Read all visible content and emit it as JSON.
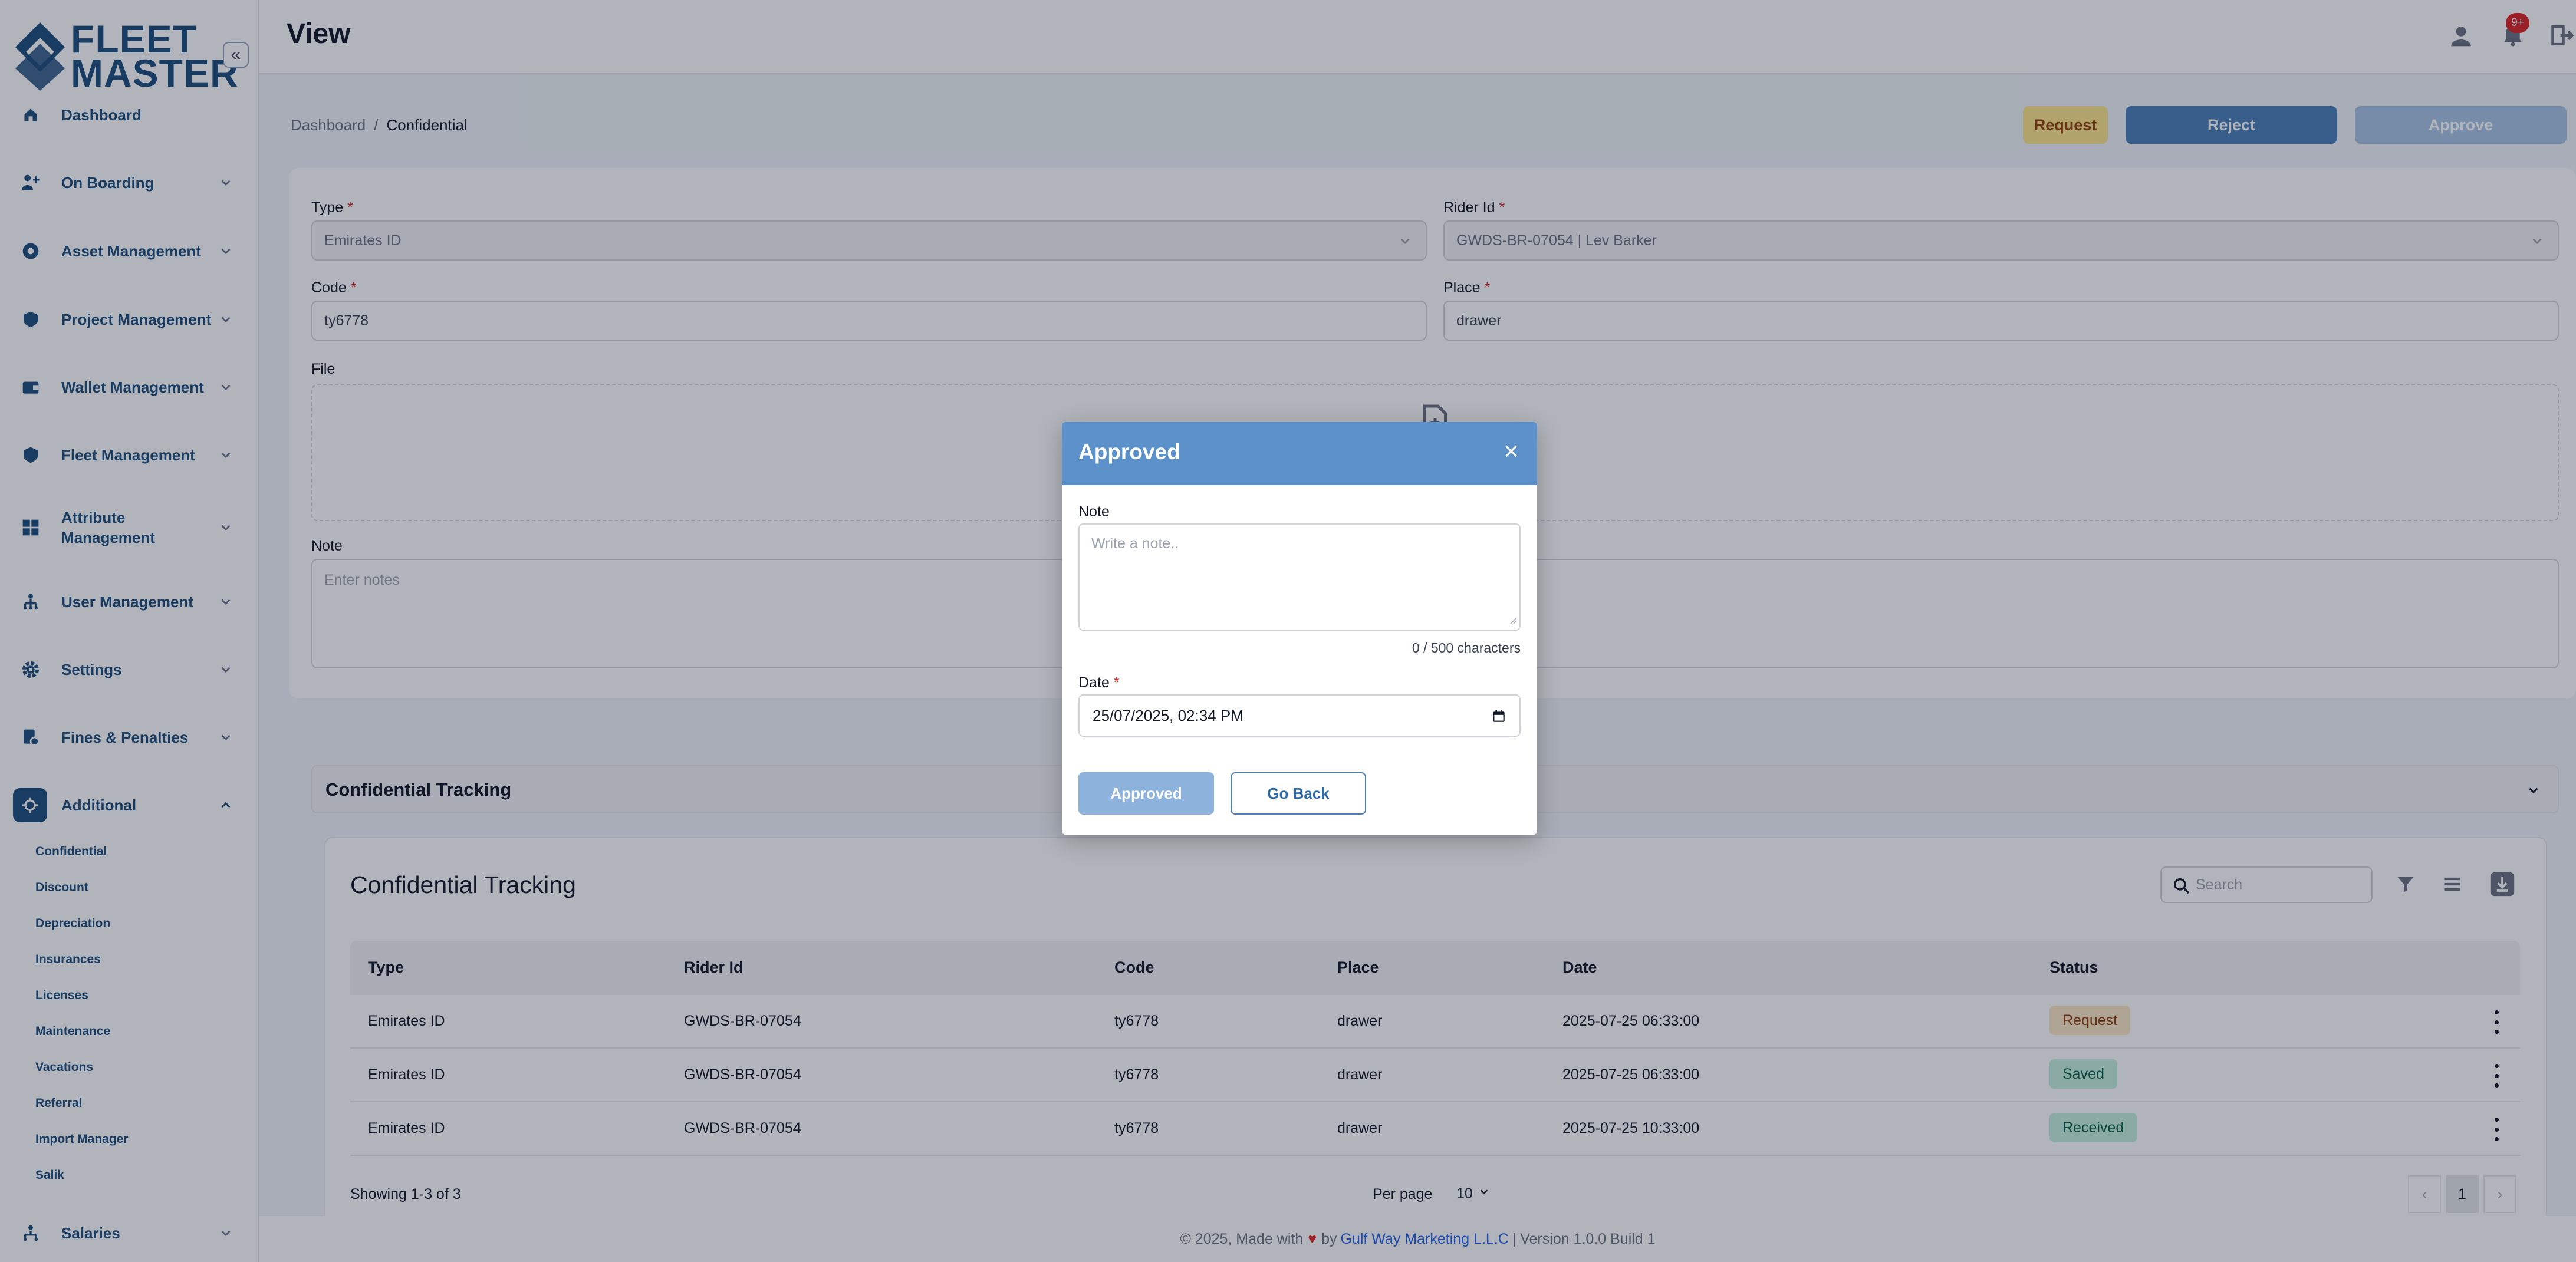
{
  "app": {
    "logo_line1": "FLEET",
    "logo_line2": "MASTER",
    "page_title": "View"
  },
  "topbar": {
    "notification_count": "9+"
  },
  "sidebar": {
    "items": [
      {
        "label": "Dashboard",
        "icon": "home-icon"
      },
      {
        "label": "On Boarding",
        "icon": "onboarding-icon"
      },
      {
        "label": "Asset Management",
        "icon": "asset-icon"
      },
      {
        "label": "Project Management",
        "icon": "project-icon"
      },
      {
        "label": "Wallet Management",
        "icon": "wallet-icon"
      },
      {
        "label": "Fleet Management",
        "icon": "fleet-icon"
      },
      {
        "label": "Attribute Management",
        "icon": "attribute-icon"
      },
      {
        "label": "User Management",
        "icon": "users-icon"
      },
      {
        "label": "Settings",
        "icon": "gear-icon"
      },
      {
        "label": "Fines & Penalties",
        "icon": "fines-icon"
      },
      {
        "label": "Additional",
        "icon": "additional-icon"
      },
      {
        "label": "Salaries",
        "icon": "salaries-icon"
      }
    ],
    "attribute_line1": "Attribute",
    "attribute_line2": "Management",
    "sub_items": [
      "Confidential",
      "Discount",
      "Depreciation",
      "Insurances",
      "Licenses",
      "Maintenance",
      "Vacations",
      "Referral",
      "Import Manager",
      "Salik"
    ]
  },
  "breadcrumb": {
    "root": "Dashboard",
    "separator": "/",
    "current": "Confidential"
  },
  "actions": {
    "request": "Request",
    "reject": "Reject",
    "approve": "Approve"
  },
  "form": {
    "type_label": "Type",
    "type_value": "Emirates ID",
    "rider_label": "Rider Id",
    "rider_value": "GWDS-BR-07054 | Lev Barker",
    "code_label": "Code",
    "code_value": "ty6778",
    "place_label": "Place",
    "place_value": "drawer",
    "file_label": "File",
    "note_label": "Note",
    "note_placeholder": "Enter notes",
    "required_mark": "*"
  },
  "tracking": {
    "section_title": "Confidential Tracking",
    "panel_title": "Confidential Tracking",
    "search_placeholder": "Search",
    "columns": [
      "Type",
      "Rider Id",
      "Code",
      "Place",
      "Date",
      "Status"
    ],
    "rows": [
      {
        "type": "Emirates ID",
        "rider": "GWDS-BR-07054",
        "code": "ty6778",
        "place": "drawer",
        "date": "2025-07-25 06:33:00",
        "status": "Request"
      },
      {
        "type": "Emirates ID",
        "rider": "GWDS-BR-07054",
        "code": "ty6778",
        "place": "drawer",
        "date": "2025-07-25 06:33:00",
        "status": "Saved"
      },
      {
        "type": "Emirates ID",
        "rider": "GWDS-BR-07054",
        "code": "ty6778",
        "place": "drawer",
        "date": "2025-07-25 10:33:00",
        "status": "Received"
      }
    ],
    "showing": "Showing 1-3 of 3",
    "per_page_label": "Per page",
    "per_page_value": "10",
    "current_page": "1"
  },
  "footer": {
    "prefix": "© 2025, Made with",
    "by": "by",
    "company": "Gulf Way Marketing L.L.C",
    "version": "| Version 1.0.0 Build 1"
  },
  "modal": {
    "title": "Approved",
    "close": "×",
    "note_label": "Note",
    "note_placeholder": "Write a note..",
    "char_count": "0 / 500 characters",
    "date_label": "Date",
    "date_value": "25/07/2025, 02:34 PM",
    "submit": "Approved",
    "go_back": "Go Back"
  },
  "colors": {
    "brand": "#1e4e7c",
    "modal_header": "#5b91c8",
    "danger": "#dc2626"
  }
}
